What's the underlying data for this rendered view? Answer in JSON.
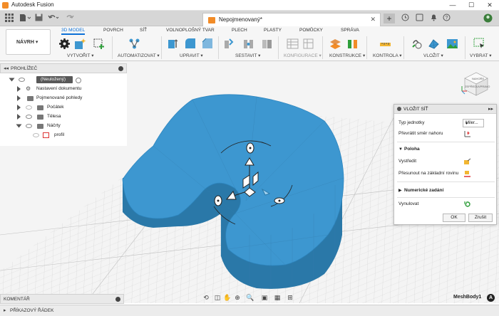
{
  "window": {
    "title": "Autodesk Fusion",
    "minimize": "—",
    "maximize": "☐",
    "close": "✕"
  },
  "toolbar": {
    "grid_icon": "grid-icon",
    "file_icon": "file-icon",
    "save_icon": "save-icon",
    "undo_icon": "undo-icon",
    "redo_icon": "redo-icon"
  },
  "document_tab": {
    "label": "Nepojmenovaný*",
    "close": "✕"
  },
  "tab_actions": [
    "+",
    "◷",
    "🔔",
    "?",
    "●"
  ],
  "ribbon": {
    "workspace": "NÁVRH ▾",
    "tabs": [
      {
        "label": "3D MODEL",
        "active": true
      },
      {
        "label": "POVRCH",
        "active": false
      },
      {
        "label": "SÍŤ",
        "active": false
      },
      {
        "label": "VOLNOPLOŠNÝ TVAR",
        "active": false
      },
      {
        "label": "PLECH",
        "active": false
      },
      {
        "label": "PLASTY",
        "active": false
      },
      {
        "label": "POMŮCKY",
        "active": false
      },
      {
        "label": "SPRÁVA",
        "active": false
      }
    ],
    "groups": [
      {
        "label": "VYTVOŘIT ▾",
        "dim": false
      },
      {
        "label": "AUTOMATIZOVAT ▾",
        "dim": false
      },
      {
        "label": "UPRAVIT ▾",
        "dim": false
      },
      {
        "label": "SESTAVIT ▾",
        "dim": false
      },
      {
        "label": "KONFIGURACE ▾",
        "dim": true
      },
      {
        "label": "KONSTRUKCE ▾",
        "dim": false
      },
      {
        "label": "KONTROLA ▾",
        "dim": false
      },
      {
        "label": "VLOŽIT ▾",
        "dim": false
      },
      {
        "label": "VYBRAT ▾",
        "dim": false
      }
    ]
  },
  "browser": {
    "title": "PROHLÍŽEČ",
    "root": "(Neuložený)",
    "items": [
      "Nastavení dokumentu",
      "Pojmenované pohledy",
      "Počátek",
      "Tělesa",
      "Náčrty",
      "profil"
    ]
  },
  "viewcube": {
    "faces": [
      "NAHOŘE",
      "ZEPŘEDU",
      "VPRAVO"
    ]
  },
  "dialog": {
    "title": "VLOŽIT SÍŤ",
    "unit_label": "Typ jednotky",
    "unit_value": "Miler...",
    "flip_label": "Převrátit směr nahoru",
    "position_section": "Poloha",
    "center_label": "Vystředit",
    "move_to_ground_label": "Přesunout na základní rovinu",
    "numeric_section": "Numerické zadání",
    "reset_label": "Vynulovat",
    "ok": "OK",
    "cancel": "Zrušit"
  },
  "bottom": {
    "comments": "KOMENTÁŘ",
    "command_line": "PŘÍKAZOVÝ ŘÁDEK",
    "body_name": "MeshBody1",
    "a360_icon": "A"
  },
  "colors": {
    "mesh": "#3d97d0",
    "mesh_dark": "#2a78a8",
    "accent": "#0a6fd6",
    "grid": "#c9c9c9"
  }
}
